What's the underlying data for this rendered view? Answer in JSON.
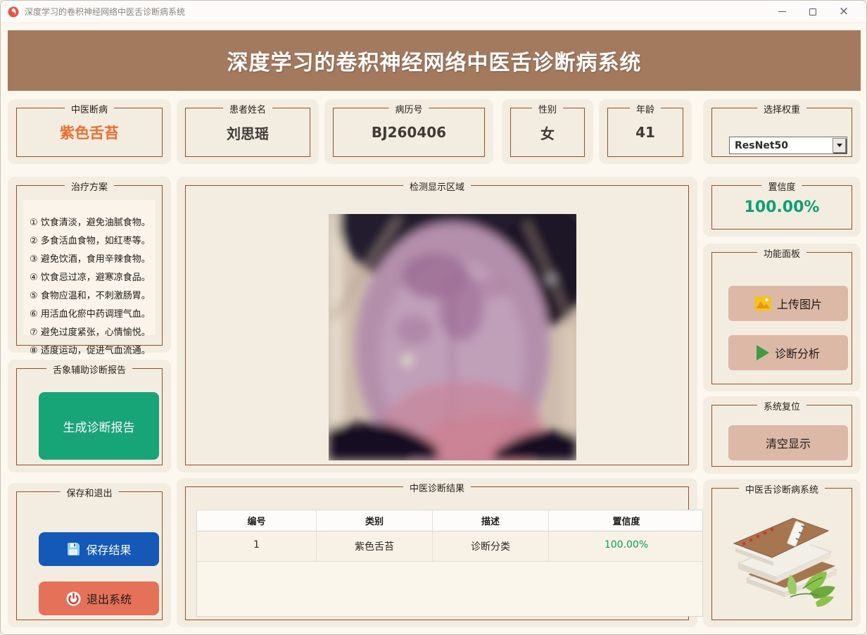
{
  "window": {
    "title": "深度学习的卷积神经网络中医舌诊断病系统",
    "controls": {
      "minimize": "最小化",
      "maximize": "最大化",
      "close": "关闭"
    }
  },
  "header": {
    "title": "深度学习的卷积神经网络中医舌诊断病系统"
  },
  "info": {
    "diagnosis": {
      "label": "中医断病",
      "value": "紫色舌苔"
    },
    "patient": {
      "label": "患者姓名",
      "value": "刘思瑶"
    },
    "record": {
      "label": "病历号",
      "value": "BJ260406"
    },
    "gender": {
      "label": "性别",
      "value": "女"
    },
    "age": {
      "label": "年龄",
      "value": "41"
    },
    "weight": {
      "label": "选择权重",
      "value": "ResNet50"
    }
  },
  "treatment": {
    "label": "治疗方案",
    "items": [
      "① 饮食清淡，避免油腻食物。",
      "② 多食活血食物，如红枣等。",
      "③ 避免饮酒，食用辛辣食物。",
      "④ 饮食忌过凉，避寒凉食品。",
      "⑤ 食物应温和，不刺激肠胃。",
      "⑥ 用活血化瘀中药调理气血。",
      "⑦ 避免过度紧张，心情愉悦。",
      "⑧ 适度运动，促进气血流通。"
    ]
  },
  "report": {
    "label": "舌象辅助诊断报告",
    "button": "生成诊断报告"
  },
  "save_exit": {
    "label": "保存和退出",
    "save": "保存结果",
    "exit": "退出系统"
  },
  "detection": {
    "label": "检测显示区域"
  },
  "confidence": {
    "label": "置信度",
    "value": "100.00%"
  },
  "functions": {
    "label": "功能面板",
    "upload": "上传图片",
    "analyze": "诊断分析"
  },
  "reset": {
    "label": "系统复位",
    "clear": "清空显示"
  },
  "branding": {
    "label": "中医舌诊断病系统"
  },
  "results": {
    "label": "中医诊断结果",
    "columns": [
      "编号",
      "类别",
      "描述",
      "置信度"
    ],
    "rows": [
      {
        "no": "1",
        "category": "紫色舌苔",
        "desc": "诊断分类",
        "conf": "100.00%"
      }
    ]
  },
  "icons": {
    "app": "tcm-swirl-logo",
    "save": "floppy-disk",
    "exit": "power",
    "upload": "picture-image",
    "analyze": "play-triangle",
    "weight_dropdown": "caret-down",
    "branding_art": "stacked-books-with-leaves"
  },
  "colors": {
    "banner": "#a47a5e",
    "panel_bg": "#f3ece1",
    "group_border": "#96511f",
    "diagnosis_orange": "#ed6f2d",
    "report_green": "#17a477",
    "save_blue": "#1458b8",
    "exit_salmon": "#e57258",
    "tan_button": "#dcb9a7",
    "confidence_green": "#0aa173",
    "table_conf_green": "#00a850"
  }
}
